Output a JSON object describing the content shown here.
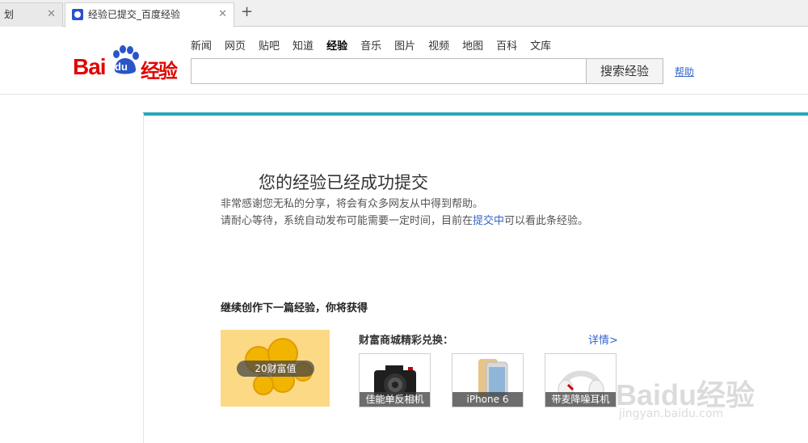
{
  "browser": {
    "tabs": [
      {
        "label": "划",
        "active": false
      },
      {
        "label": "经验已提交_百度经验",
        "active": true
      }
    ],
    "new_tab": "+"
  },
  "header": {
    "logo": {
      "bai": "Bai",
      "du": "du",
      "jingyan": "经验"
    },
    "nav": [
      "新闻",
      "网页",
      "贴吧",
      "知道",
      "经验",
      "音乐",
      "图片",
      "视频",
      "地图",
      "百科",
      "文库"
    ],
    "nav_active": "经验",
    "search": {
      "value": "",
      "placeholder": "",
      "button": "搜索经验"
    },
    "help": "帮助"
  },
  "main": {
    "title": "您的经验已经成功提交",
    "line1": "非常感谢您无私的分享，将会有众多网友从中得到帮助。",
    "line2_prefix": "请耐心等待，系统自动发布可能需要一定时间，目前在",
    "line2_link": "提交中",
    "line2_suffix": "可以看此条经验。",
    "continue_heading": "继续创作下一篇经验，你将获得",
    "reward_label": "20财富值",
    "mall_title": "财富商城精彩兑换：",
    "mall_more": "详情>",
    "products": [
      {
        "name": "佳能单反相机"
      },
      {
        "name": "iPhone 6"
      },
      {
        "name": "带麦降噪耳机"
      }
    ]
  },
  "watermark": {
    "text": "Baidu经验",
    "sub": "jingyan.baidu.com"
  },
  "colors": {
    "accent": "#28a7b7",
    "brand_red": "#e10601",
    "link": "#3366cc"
  }
}
